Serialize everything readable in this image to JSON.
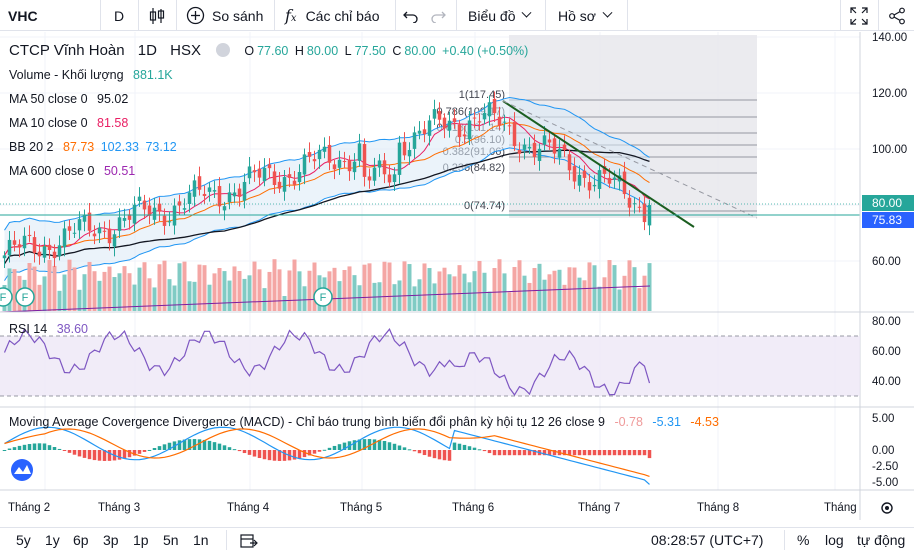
{
  "toolbar": {
    "symbol": "VHC",
    "interval": "D",
    "compare_label": "So sánh",
    "indicators_label": "Các chỉ báo",
    "chart_type_label": "Biểu đồ",
    "profile_label": "Hồ sơ"
  },
  "legend": {
    "title": "CTCP Vĩnh Hoàn",
    "interval": "1D",
    "exchange": "HSX",
    "o_label": "O",
    "o": "77.60",
    "h_label": "H",
    "h": "80.00",
    "l_label": "L",
    "l": "77.50",
    "c_label": "C",
    "c": "80.00",
    "change": "+0.40 (+0.50%)",
    "volume_label": "Volume - Khối lượng",
    "volume_value": "881.1K",
    "ma50_label": "MA 50 close 0",
    "ma50_value": "95.02",
    "ma10_label": "MA 10 close 0",
    "ma10_value": "81.58",
    "bb_label": "BB 20 2",
    "bb_v1": "87.73",
    "bb_v2": "102.33",
    "bb_v3": "73.12",
    "ma600_label": "MA 600 close 0",
    "ma600_value": "50.51",
    "rsi_label": "RSI 14",
    "rsi_value": "38.60",
    "macd_label": "Moving Average Covergence Divergence (MACD) - Chỉ báo trung bình biến đổi phân kỳ hội tụ 12 26 close 9",
    "macd_v1": "-0.78",
    "macd_v2": "-5.31",
    "macd_v3": "-4.53"
  },
  "fib_levels": [
    {
      "label": "1(117.45)"
    },
    {
      "label": "0.786(109.17)"
    },
    {
      "label": "0.618(101.14)"
    },
    {
      "label": "0.5(96.10)"
    },
    {
      "label": "0.382(91.06)"
    },
    {
      "label": "0.236(84.82)"
    },
    {
      "label": "0(74.74)"
    }
  ],
  "price_axis": {
    "ticks": [
      "140.00",
      "120.00",
      "100.00",
      "60.00"
    ],
    "last_price": "80.00",
    "line_price": "75.83"
  },
  "rsi_axis": {
    "ticks": [
      "80.00",
      "60.00",
      "40.00"
    ]
  },
  "macd_axis": {
    "ticks": [
      "5.00",
      "0.00",
      "-2.50",
      "-5.00"
    ]
  },
  "time_axis": {
    "labels": [
      "Tháng 2",
      "Tháng 3",
      "Tháng 4",
      "Tháng 5",
      "Tháng 6",
      "Tháng 7",
      "Tháng 8",
      "Tháng"
    ]
  },
  "bottom": {
    "ranges": [
      "5y",
      "1y",
      "6p",
      "3p",
      "1p",
      "5n",
      "1n"
    ],
    "time": "08:28:57 (UTC+7)",
    "percent": "%",
    "log": "log",
    "auto": "tự động"
  },
  "colors": {
    "up": "#26a69a",
    "down": "#ef5350",
    "ma50": "#131722",
    "ma10": "#e91e63",
    "bb_mid": "#ff6d00",
    "bb_band": "#2196f3",
    "ma600": "#9c27b0",
    "trend": "#1b5e20",
    "rsi": "#7e57c2",
    "macd": "#2196f3",
    "signal": "#ff6d00",
    "accent": "#2962ff"
  },
  "chart_data": {
    "type": "candlestick",
    "symbol": "VHC",
    "price_range": [
      55,
      140
    ],
    "last": {
      "open": 77.6,
      "high": 80.0,
      "low": 77.5,
      "close": 80.0
    }
  }
}
